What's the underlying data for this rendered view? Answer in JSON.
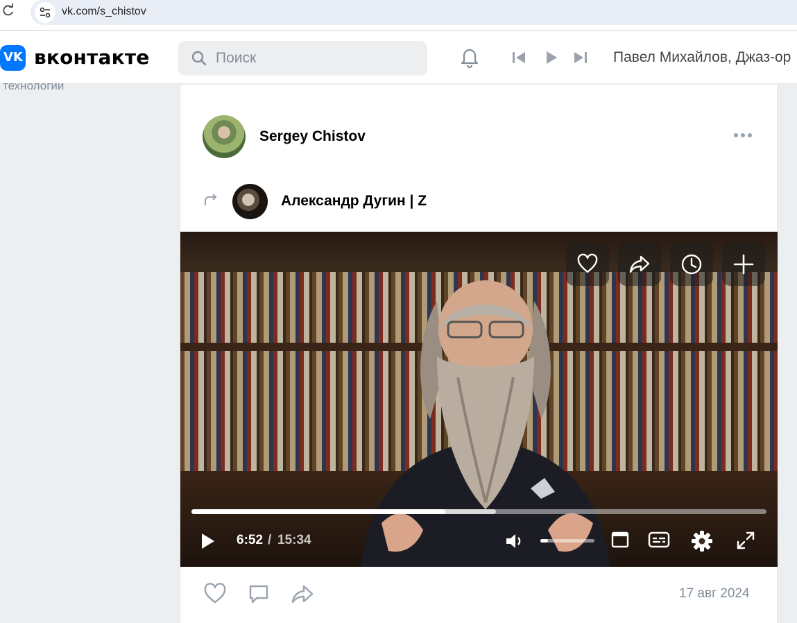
{
  "browser": {
    "url": "vk.com/s_chistov"
  },
  "header": {
    "logo_text": "вконтакте",
    "search_placeholder": "Поиск",
    "now_playing": "Павел Михайлов, Джаз-ор"
  },
  "sidebar": {
    "cut_item": "технологии"
  },
  "post": {
    "author": "Sergey Chistov",
    "reposted_from": "Александр Дугин | Z",
    "date": "17 авг 2024",
    "video": {
      "current_time": "6:52",
      "separator": "/",
      "duration": "15:34",
      "progress": 0.441,
      "buffered": 0.529,
      "volume": 0.14
    }
  },
  "icons": [
    "reload-icon",
    "site-info-icon",
    "search-icon",
    "bell-icon",
    "previous-track-icon",
    "play-track-icon",
    "next-track-icon",
    "more-icon",
    "repost-icon",
    "like-icon",
    "share-icon",
    "watch-later-icon",
    "add-icon",
    "play-icon",
    "volume-icon",
    "miniplayer-icon",
    "subtitles-icon",
    "settings-icon",
    "fullscreen-icon",
    "comment-icon"
  ],
  "colors": {
    "vk_blue": "#0077ff",
    "muted_text": "#818c99",
    "page_bg": "#edeef0"
  }
}
